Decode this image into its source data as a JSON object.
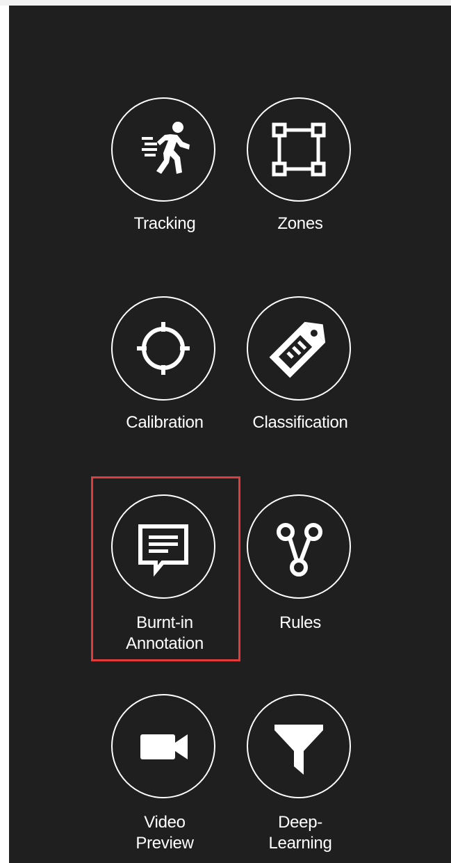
{
  "tiles": {
    "tracking": {
      "label": "Tracking",
      "icon": "running-person-icon"
    },
    "zones": {
      "label": "Zones",
      "icon": "bounding-box-icon"
    },
    "calibration": {
      "label": "Calibration",
      "icon": "crosshair-icon"
    },
    "classification": {
      "label": "Classification",
      "icon": "tag-icon"
    },
    "burnt_in_annotation": {
      "label_line1": "Burnt-in",
      "label_line2": "Annotation",
      "icon": "comment-icon",
      "selected": true
    },
    "rules": {
      "label": "Rules",
      "icon": "branch-nodes-icon"
    },
    "video_preview": {
      "label_line1": "Video",
      "label_line2": "Preview",
      "icon": "video-camera-icon"
    },
    "deep_learning": {
      "label_line1": "Deep-",
      "label_line2": "Learning",
      "icon": "filter-icon"
    }
  },
  "colors": {
    "background": "#201f1f",
    "foreground": "#ffffff",
    "selection": "#e23b3b"
  }
}
